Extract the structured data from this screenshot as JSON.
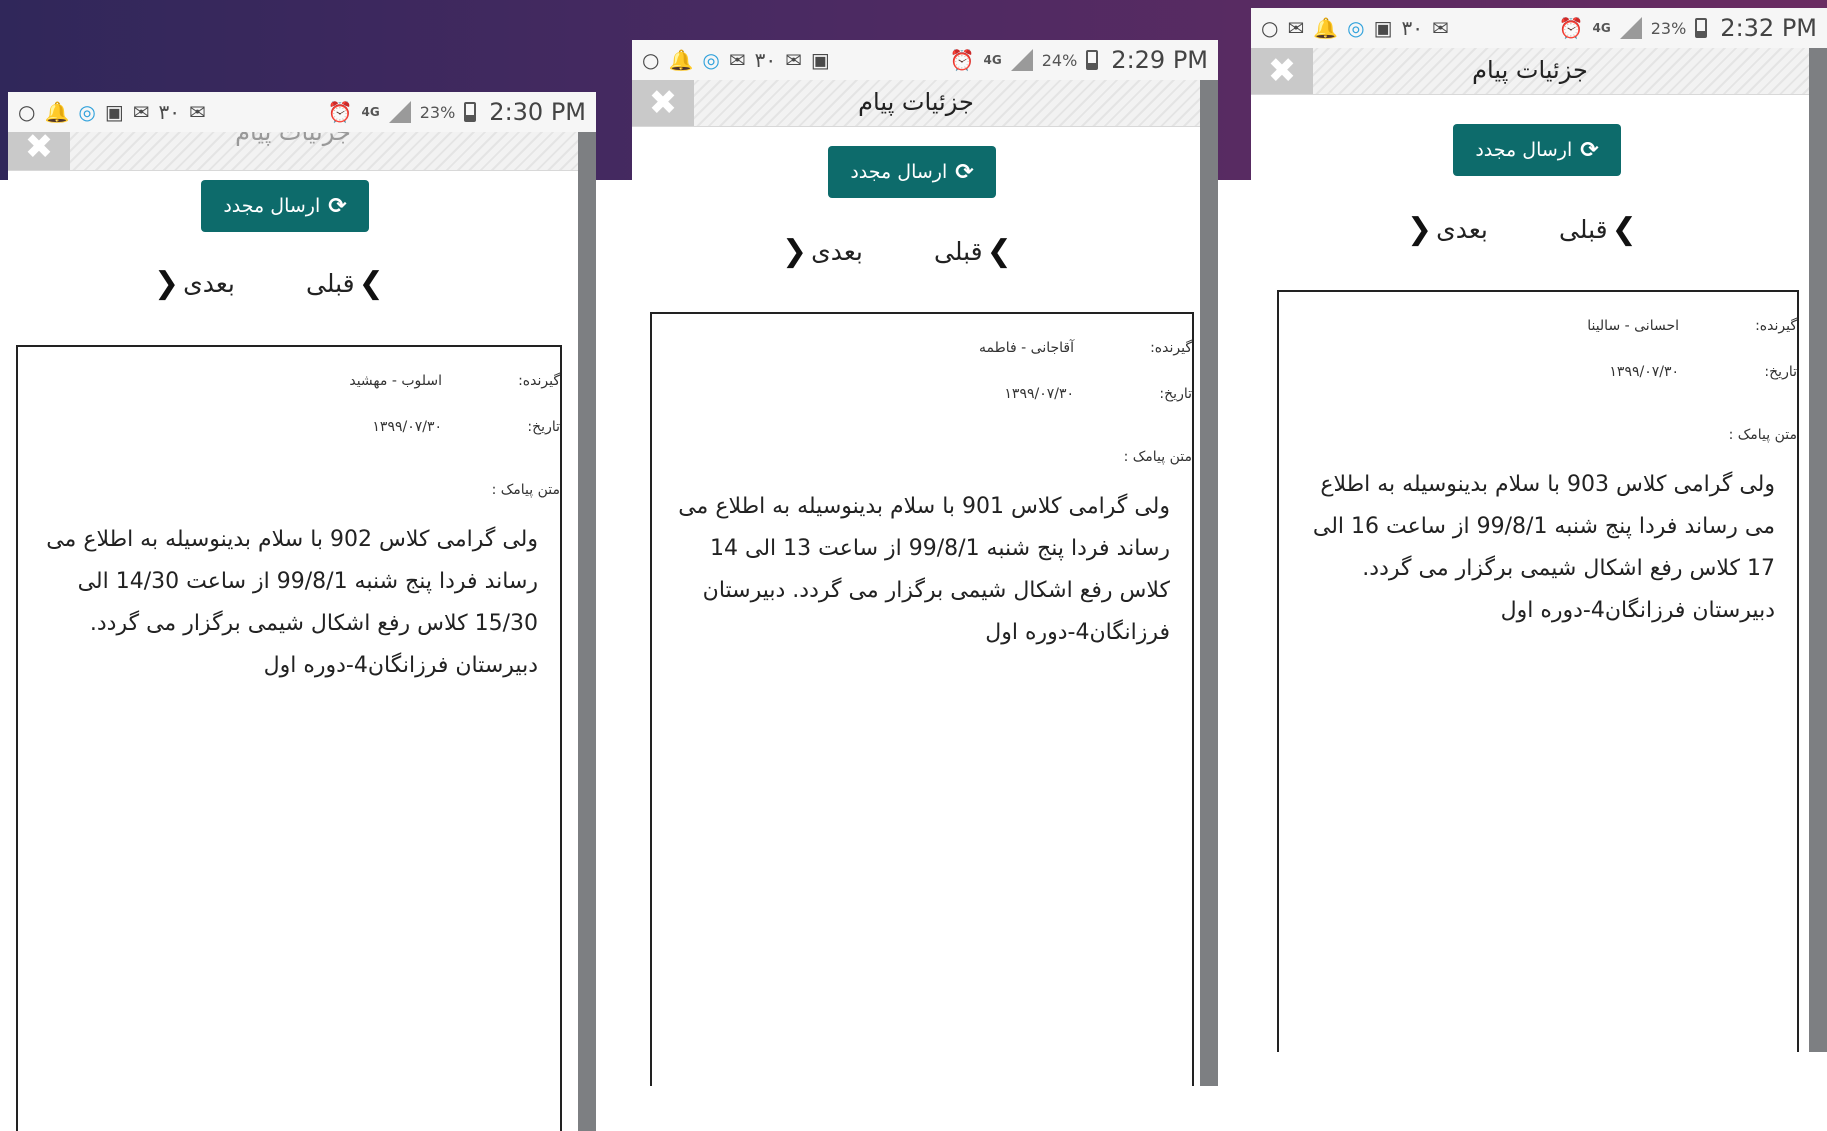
{
  "screens": [
    {
      "status": {
        "battery": "23%",
        "time": "2:30 PM",
        "network": "4G",
        "badge": "۳۰"
      },
      "title": "جزئیات پیام",
      "close_icon": "close-icon",
      "resend_label": "ارسال مجدد",
      "nav": {
        "prev": "قبلی",
        "next": "بعدی"
      },
      "recipient_label": "گیرنده:",
      "recipient": "اسلوب - مهشید",
      "date_label": "تاریخ:",
      "date": "۱۳۹۹/۰۷/۳۰",
      "sms_label": "متن پیامک :",
      "sms_body": "ولی گرامی کلاس 902 با سلام بدینوسیله به اطلاع می رساند فردا پنج شنبه 99/8/1 از ساعت 14/30 الی 15/30 کلاس رفع اشکال شیمی برگزار می گردد. دبیرستان فرزانگان4-دوره اول"
    },
    {
      "status": {
        "battery": "24%",
        "time": "2:29 PM",
        "network": "4G",
        "badge": "۳۰"
      },
      "title": "جزئیات پیام",
      "close_icon": "close-icon",
      "resend_label": "ارسال مجدد",
      "nav": {
        "prev": "قبلی",
        "next": "بعدی"
      },
      "recipient_label": "گیرنده:",
      "recipient": "آقاجانی - فاطمه",
      "date_label": "تاریخ:",
      "date": "۱۳۹۹/۰۷/۳۰",
      "sms_label": "متن پیامک :",
      "sms_body": "ولی گرامی کلاس 901 با سلام بدینوسیله به اطلاع می رساند فردا پنج شنبه 99/8/1 از ساعت 13 الی 14 کلاس رفع اشکال شیمی برگزار می گردد. دبیرستان فرزانگان4-دوره اول"
    },
    {
      "status": {
        "battery": "23%",
        "time": "2:32 PM",
        "network": "4G",
        "badge": "۳۰"
      },
      "title": "جزئیات پیام",
      "close_icon": "close-icon",
      "resend_label": "ارسال مجدد",
      "nav": {
        "prev": "قبلی",
        "next": "بعدی"
      },
      "recipient_label": "گیرنده:",
      "recipient": "احسانی - سالینا",
      "date_label": "تاریخ:",
      "date": "۱۳۹۹/۰۷/۳۰",
      "sms_label": "متن پیامک :",
      "sms_body": "ولی گرامی کلاس 903 با سلام بدینوسیله به اطلاع می رساند فردا پنج شنبه 99/8/1 از ساعت 16 الی 17 کلاس رفع اشکال شیمی برگزار می گردد. دبیرستان فرزانگان4-دوره اول"
    }
  ],
  "colors": {
    "accent": "#0d6b6b",
    "background_band": "#4b2a62"
  }
}
